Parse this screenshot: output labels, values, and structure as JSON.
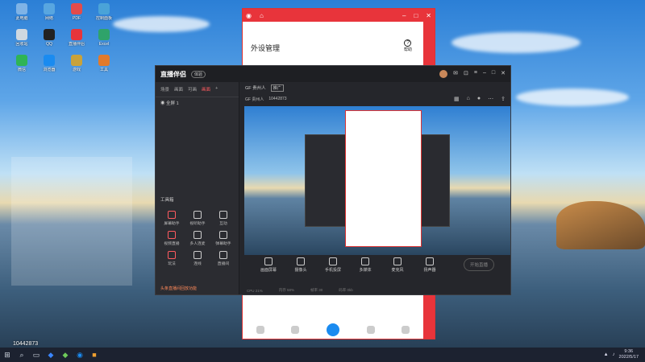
{
  "desktop": {
    "icons": [
      {
        "label": "此电脑",
        "color": "#7fb3e6"
      },
      {
        "label": "网络",
        "color": "#58a6e0"
      },
      {
        "label": "PDF",
        "color": "#e34b4b"
      },
      {
        "label": "控制面板",
        "color": "#4aa3d8"
      },
      {
        "label": "回收站",
        "color": "#cfd8e0"
      },
      {
        "label": "QQ",
        "color": "#222"
      },
      {
        "label": "直播伴侣",
        "color": "#e8343b"
      },
      {
        "label": "Excel",
        "color": "#2fa36a"
      },
      {
        "label": "微信",
        "color": "#2fb455"
      },
      {
        "label": "浏览器",
        "color": "#1a8bf0"
      },
      {
        "label": "游戏",
        "color": "#c9a23a"
      },
      {
        "label": "工具",
        "color": "#e27a2b"
      }
    ]
  },
  "taskbar": {
    "start_icon": "⊞",
    "time": "9:36",
    "date": "2022/5/17",
    "id_overlay": "10442873"
  },
  "phone": {
    "title": "外设管理",
    "help_label": "帮助"
  },
  "app": {
    "logo": "直播伴侣",
    "badge": "体验",
    "tabs": [
      "场景",
      "画面",
      "可画",
      "画面",
      "+"
    ],
    "scene_item": "全屏 1",
    "tools_header": "工具箱",
    "tools": [
      {
        "label": "屏幕助手",
        "red": true
      },
      {
        "label": "视听助手",
        "red": false
      },
      {
        "label": "互动",
        "red": false
      },
      {
        "label": "视频直播",
        "red": true
      },
      {
        "label": "多人连麦",
        "red": false
      },
      {
        "label": "弹幕助手",
        "red": false
      },
      {
        "label": "玩法",
        "red": true
      },
      {
        "label": "连线",
        "red": false
      },
      {
        "label": "直播间",
        "red": false
      }
    ],
    "left_foot": "头条直播间回放功能",
    "info_left": "GF 贵州人",
    "info_tag": "推广",
    "sub_name": "GF 贵州人",
    "sub_id": "10442873",
    "controls": [
      "画面屏幕",
      "摄像头",
      "手机投屏",
      "多媒体",
      "麦克风",
      "扬声器"
    ],
    "start_label": "开始直播",
    "status_items": [
      "CPU 21%",
      "内存 58%",
      "帧率 30",
      "码率 0kb"
    ]
  }
}
